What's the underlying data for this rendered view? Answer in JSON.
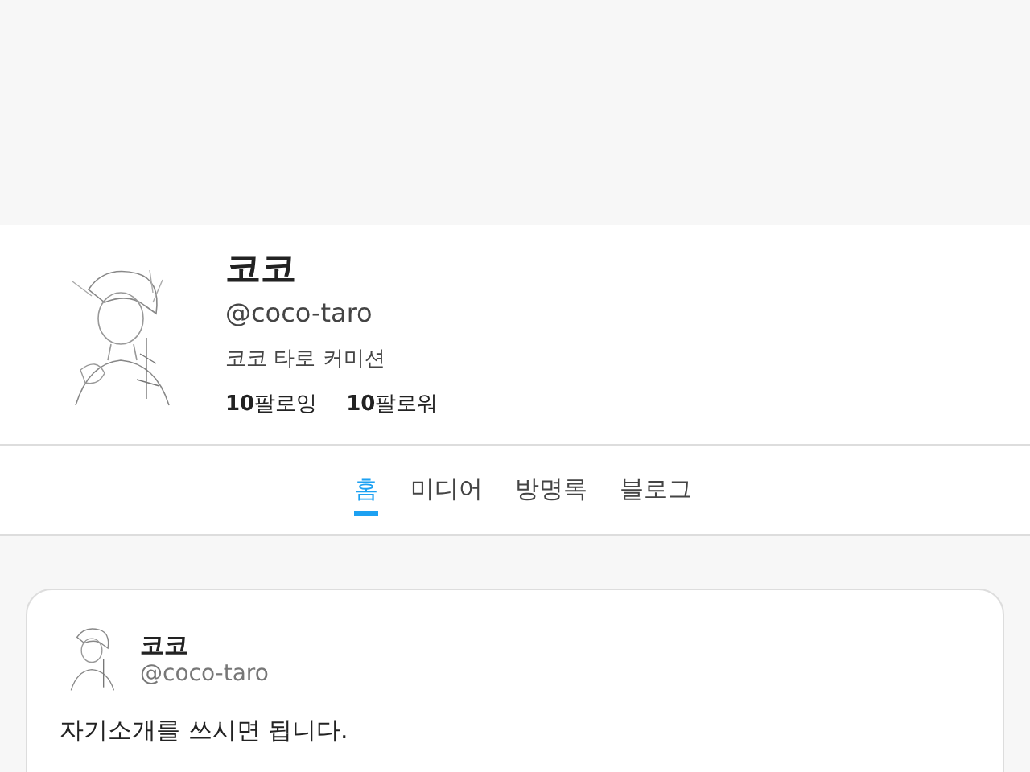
{
  "profile": {
    "name": "코코",
    "handle": "@coco-taro",
    "bio": "코코 타로 커미션",
    "stats": [
      {
        "count": "10",
        "label": "팔로잉"
      },
      {
        "count": "10",
        "label": "팔로워"
      }
    ]
  },
  "tabs": [
    {
      "label": "홈",
      "selected": true
    },
    {
      "label": "미디어",
      "selected": false
    },
    {
      "label": "방명록",
      "selected": false
    },
    {
      "label": "블로그",
      "selected": false
    }
  ],
  "post": {
    "author": "코코",
    "handle": "@coco-taro",
    "lines": [
      "자기소개를 쓰시면 됩니다."
    ]
  }
}
